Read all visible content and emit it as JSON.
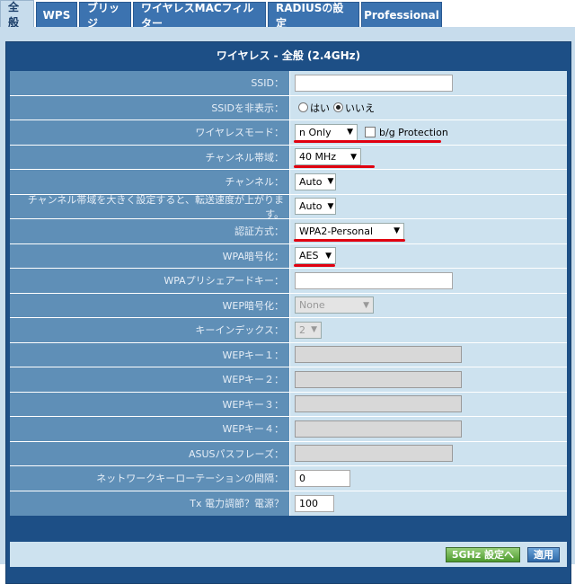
{
  "tabs": [
    {
      "label": "全般",
      "active": true
    },
    {
      "label": "WPS",
      "active": false
    },
    {
      "label": "ブリッジ",
      "active": false
    },
    {
      "label": "ワイヤレスMACフィルター",
      "active": false
    },
    {
      "label": "RADIUSの設定",
      "active": false
    },
    {
      "label": "Professional",
      "active": false
    }
  ],
  "panel_title": "ワイヤレス - 全般 (2.4GHz)",
  "rows": {
    "ssid": {
      "label": "SSID："
    },
    "hide_ssid": {
      "label": "SSIDを非表示：",
      "yes": "はい",
      "no": "いいえ"
    },
    "wireless_mode": {
      "label": "ワイヤレスモード：",
      "value": "n Only",
      "bg_protection": "b/g Protection"
    },
    "channel_width": {
      "label": "チャンネル帯域：",
      "value": "40 MHz"
    },
    "channel": {
      "label": "チャンネル：",
      "value": "Auto"
    },
    "ext_channel": {
      "label": "チャンネル帯域を大きく設定すると、転送速度が上がります。",
      "value": "Auto"
    },
    "auth_method": {
      "label": "認証方式：",
      "value": "WPA2-Personal"
    },
    "wpa_encryption": {
      "label": "WPA暗号化：",
      "value": "AES"
    },
    "wpa_psk": {
      "label": "WPAプリシェアードキー："
    },
    "wep_encryption": {
      "label": "WEP暗号化：",
      "value": "None"
    },
    "key_index": {
      "label": "キーインデックス：",
      "value": "2"
    },
    "wep_key1": {
      "label": "WEPキー１："
    },
    "wep_key2": {
      "label": "WEPキー２："
    },
    "wep_key3": {
      "label": "WEPキー３："
    },
    "wep_key4": {
      "label": "WEPキー４："
    },
    "asus_passphrase": {
      "label": "ASUSパスフレーズ："
    },
    "key_rotation": {
      "label": "ネットワークキーローテーションの間隔：",
      "value": "0"
    },
    "tx_power": {
      "label": "Tx 電力調節？電源？",
      "value": "100"
    }
  },
  "buttons": {
    "band_5ghz": "5GHz 設定へ",
    "apply": "適用"
  },
  "colors": {
    "tab_blue": "#3c73b0",
    "label_bg": "#5f8fb7",
    "value_bg": "#cde2ef",
    "annotation_red": "#e00010"
  }
}
